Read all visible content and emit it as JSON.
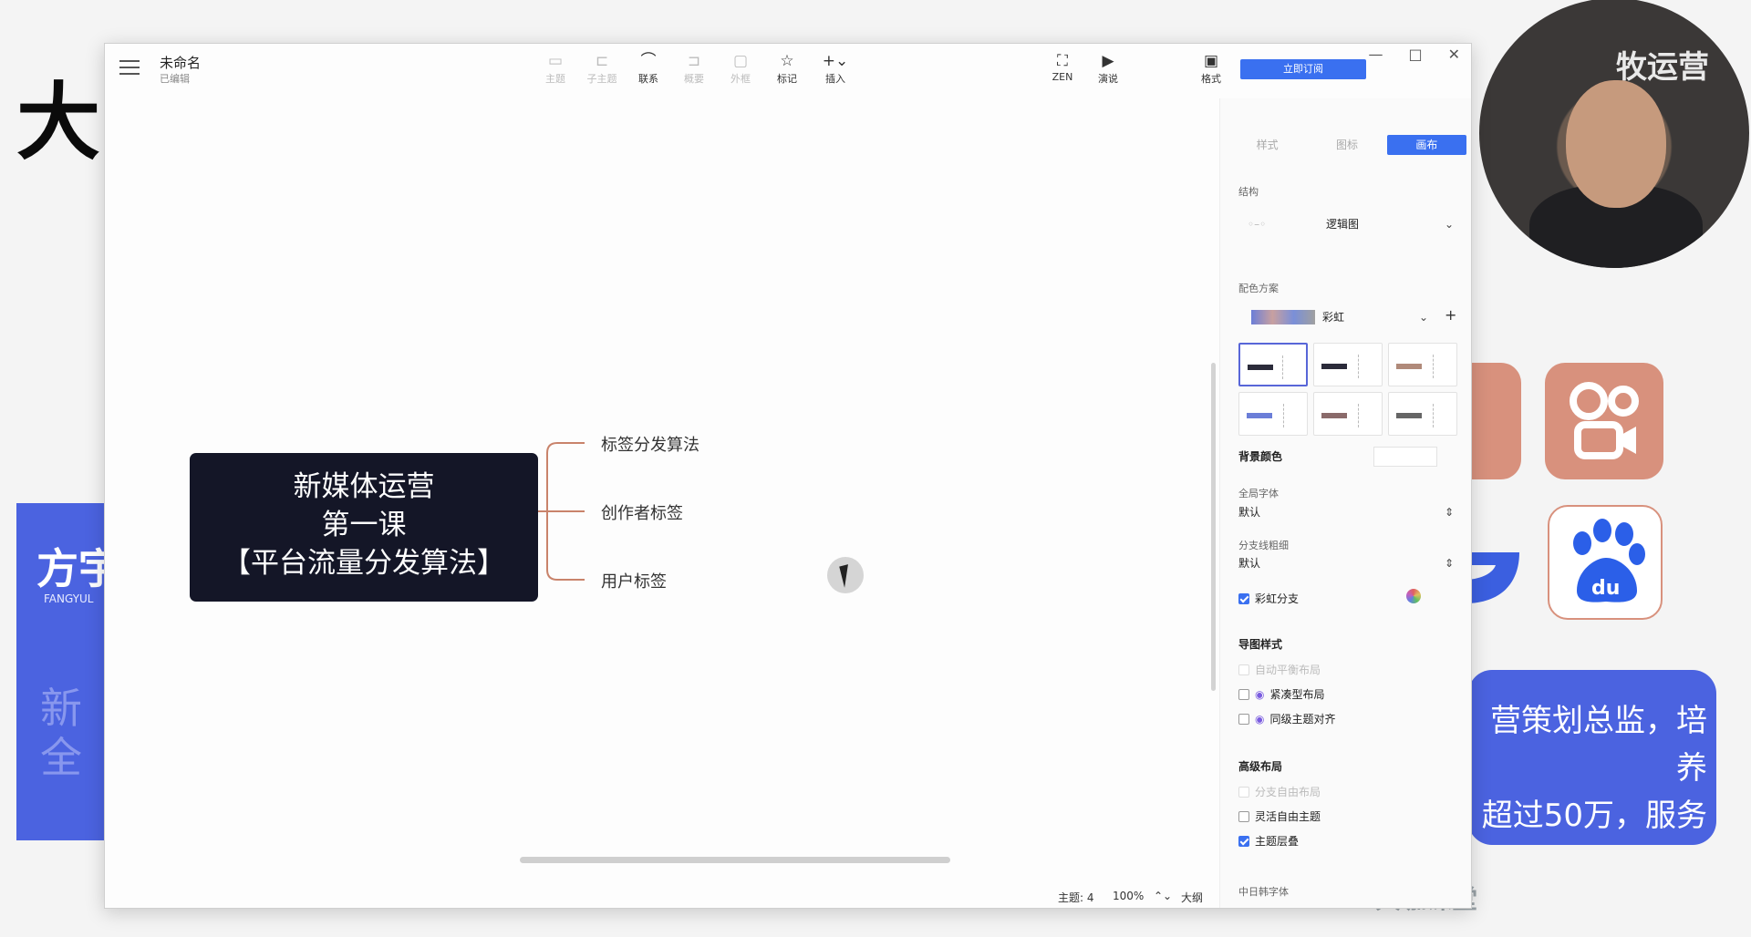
{
  "background_slide": {
    "big_char": "大",
    "blue_title": "方宇",
    "blue_sub": "FANGYUL",
    "blue_faded_line1": "新",
    "blue_faded_line2": "全",
    "right_text_line1": "营策划总监，培养",
    "right_text_line2": "超过50万，服务",
    "brand": "大咖课堂",
    "webcam_text": "牧运营"
  },
  "window": {
    "title": "未命名",
    "status": "已编辑",
    "controls": [
      "—",
      "□",
      "✕"
    ]
  },
  "toolbar": {
    "tools": [
      {
        "label": "主题",
        "icon": "topic-icon",
        "glyph": "▭",
        "disabled": true
      },
      {
        "label": "子主题",
        "icon": "subtopic-icon",
        "glyph": "⊏",
        "disabled": true
      },
      {
        "label": "联系",
        "icon": "relationship-icon",
        "glyph": "⌒",
        "disabled": false
      },
      {
        "label": "概要",
        "icon": "summary-icon",
        "glyph": "⊐",
        "disabled": true
      },
      {
        "label": "外框",
        "icon": "boundary-icon",
        "glyph": "▢",
        "disabled": true
      },
      {
        "label": "标记",
        "icon": "marker-icon",
        "glyph": "☆",
        "disabled": false
      },
      {
        "label": "插入",
        "icon": "insert-icon",
        "glyph": "+⌄",
        "disabled": false
      }
    ],
    "zen": {
      "label": "ZEN",
      "glyph": "⛶"
    },
    "present": {
      "label": "演说",
      "glyph": "▶"
    },
    "format": {
      "label": "格式",
      "glyph": "▣"
    },
    "subscribe_label": "立即订阅"
  },
  "mindmap": {
    "root_line1": "新媒体运营",
    "root_line2": "第一课",
    "root_line3": "【平台流量分发算法】",
    "branches": [
      "标签分发算法",
      "创作者标签",
      "用户标签"
    ]
  },
  "statusbar": {
    "topics": "主题: 4",
    "zoom": "100%",
    "zoom_arrows": "⌃⌄",
    "outline": "大纲"
  },
  "panel": {
    "tabs": [
      "样式",
      "图标",
      "画布"
    ],
    "active_tab": "画布",
    "structure_label": "结构",
    "structure_value": "逻辑图",
    "color_scheme_label": "配色方案",
    "color_scheme_value": "彩虹",
    "add_glyph": "+",
    "background_label": "背景颜色",
    "global_font_label": "全局字体",
    "global_font_value": "默认",
    "branch_width_label": "分支线粗细",
    "branch_width_value": "默认",
    "rainbow_branch_label": "彩虹分支",
    "map_style_label": "导图样式",
    "auto_balance_label": "自动平衡布局",
    "compact_label": "紧凑型布局",
    "align_label": "同级主题对齐",
    "advanced_label": "高级布局",
    "free_layout_label": "分支自由布局",
    "flexible_label": "灵活自由主题",
    "overlap_label": "主题层叠",
    "cjk_font_label": "中日韩字体",
    "arrow_down": "⌄",
    "arrow_updown": "⇕"
  },
  "colors": {
    "accent": "#3a70f0",
    "root_fill": "#141627",
    "branch_line": "#c9836b",
    "slide_blue": "#4b63e0"
  }
}
